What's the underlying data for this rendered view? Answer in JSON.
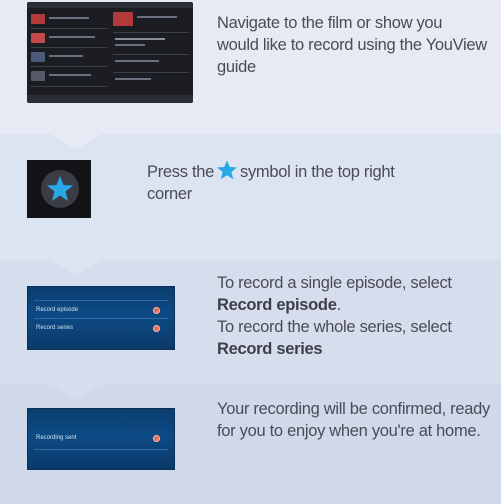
{
  "colors": {
    "star_blue": "#29a8e8",
    "text": "#4b4b55",
    "screen_blue": "#0d4a85",
    "record_dot": "#e07060"
  },
  "steps": [
    {
      "text": "Navigate to the film or show you would like to record using the YouView guide"
    },
    {
      "text_before": "Press the",
      "icon": "star-icon",
      "text_after": "symbol in the top right corner"
    },
    {
      "line1": "To record a single episode, select ",
      "bold1": "Record episode",
      "line1_end": ".",
      "line2": "To record the whole series, select ",
      "bold2": "Record series",
      "screen": {
        "item1": "Record episode",
        "item2": "Record series"
      }
    },
    {
      "text": "Your recording will be confirmed, ready for you to enjoy when you're at home.",
      "screen": {
        "item1": "Recording sent"
      }
    }
  ]
}
